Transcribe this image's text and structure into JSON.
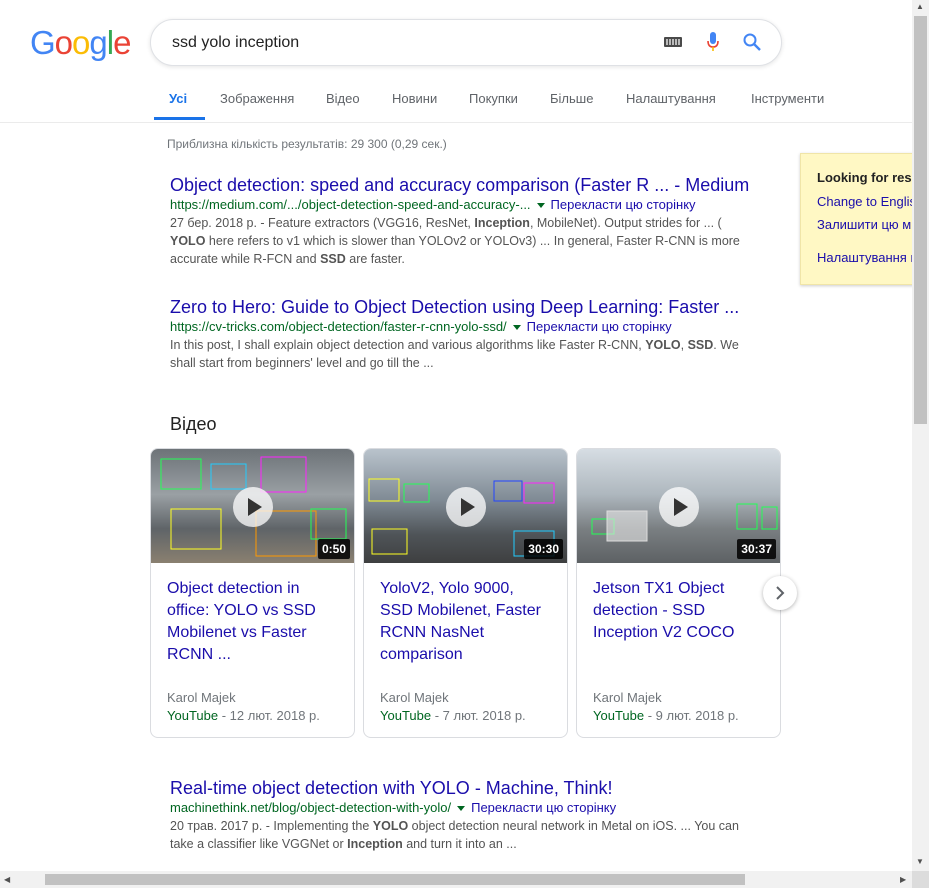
{
  "logo": {
    "letters": [
      "G",
      "o",
      "o",
      "g",
      "l",
      "e"
    ],
    "colors": [
      "#4285f4",
      "#ea4335",
      "#fbbc05",
      "#4285f4",
      "#34a853",
      "#ea4335"
    ]
  },
  "search": {
    "query": "ssd yolo inception"
  },
  "tabs": [
    {
      "label": "Усі",
      "active": true
    },
    {
      "label": "Зображення"
    },
    {
      "label": "Відео"
    },
    {
      "label": "Новини"
    },
    {
      "label": "Покупки"
    },
    {
      "label": "Більше"
    },
    {
      "label": "Налаштування"
    },
    {
      "label": "Інструменти"
    }
  ],
  "stats": "Приблизна кількість результатів: 29 300 (0,29 сек.)",
  "results": [
    {
      "title": "Object detection: speed and accuracy comparison (Faster R ... - Medium",
      "url": "https://medium.com/.../object-detection-speed-and-accuracy-...",
      "translate": "Перекласти цю сторінку",
      "snippet_html": "27 бер. 2018 р. - Feature extractors (VGG16, ResNet, <b>Inception</b>, MobileNet). Output strides for ... ( <b>YOLO</b> here refers to v1 which is slower than YOLOv2 or YOLOv3) ... In general, Faster R-CNN is more accurate while R-FCN and <b>SSD</b> are faster."
    },
    {
      "title": "Zero to Hero: Guide to Object Detection using Deep Learning: Faster ...",
      "url": "https://cv-tricks.com/object-detection/faster-r-cnn-yolo-ssd/",
      "translate": "Перекласти цю сторінку",
      "snippet_html": "In this post, I shall explain object detection and various algorithms like Faster R-CNN, <b>YOLO</b>, <b>SSD</b>. We shall start from beginners' level and go till the ..."
    },
    {
      "title": "Real-time object detection with YOLO - Machine, Think!",
      "url": "machinethink.net/blog/object-detection-with-yolo/",
      "translate": "Перекласти цю сторінку",
      "snippet_html": "20 трав. 2017 р. - Implementing the <b>YOLO</b> object detection neural network in Metal on iOS. ... You can take a classifier like VGGNet or <b>Inception</b> and turn it into an ..."
    }
  ],
  "videos": {
    "section_title": "Відео",
    "items": [
      {
        "title": "Object detection in office: YOLO vs SSD Mobilenet vs Faster RCNN ...",
        "duration": "0:50",
        "author": "Karol Majek",
        "source": "YouTube",
        "date": "12 лют. 2018 р."
      },
      {
        "title": "YoloV2, Yolo 9000, SSD Mobilenet, Faster RCNN NasNet comparison",
        "duration": "30:30",
        "author": "Karol Majek",
        "source": "YouTube",
        "date": "7 лют. 2018 р."
      },
      {
        "title": "Jetson TX1 Object detection - SSD Inception V2 COCO",
        "duration": "30:37",
        "author": "Karol Majek",
        "source": "YouTube",
        "date": "9 лют. 2018 р."
      }
    ]
  },
  "lang_panel": {
    "title": "Looking for res",
    "links": [
      "Change to Englis",
      "Залишити цю м",
      "Налаштування м"
    ]
  },
  "colors": {
    "link": "#1a0dab",
    "url": "#006621",
    "accent": "#1a73e8"
  }
}
